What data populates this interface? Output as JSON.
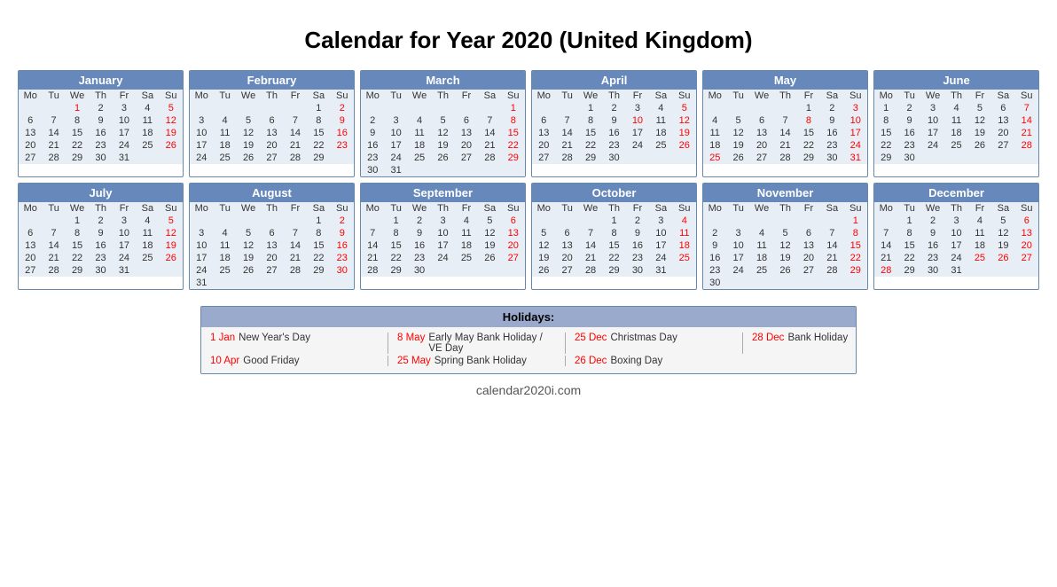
{
  "title": "Calendar for Year 2020 (United Kingdom)",
  "months": [
    {
      "name": "January",
      "days_header": [
        "Mo",
        "Tu",
        "We",
        "Th",
        "Fr",
        "Sa",
        "Su"
      ],
      "weeks": [
        [
          "",
          "",
          "1",
          "2",
          "3",
          "4",
          "5"
        ],
        [
          "6",
          "7",
          "8",
          "9",
          "10",
          "11",
          "12"
        ],
        [
          "13",
          "14",
          "15",
          "16",
          "17",
          "18",
          "19"
        ],
        [
          "20",
          "21",
          "22",
          "23",
          "24",
          "25",
          "26"
        ],
        [
          "27",
          "28",
          "29",
          "30",
          "31",
          "",
          ""
        ]
      ],
      "red_days": [
        "1"
      ]
    },
    {
      "name": "February",
      "days_header": [
        "Mo",
        "Tu",
        "We",
        "Th",
        "Fr",
        "Sa",
        "Su"
      ],
      "weeks": [
        [
          "",
          "",
          "",
          "",
          "",
          "1",
          "2"
        ],
        [
          "3",
          "4",
          "5",
          "6",
          "7",
          "8",
          "9"
        ],
        [
          "10",
          "11",
          "12",
          "13",
          "14",
          "15",
          "16"
        ],
        [
          "17",
          "18",
          "19",
          "20",
          "21",
          "22",
          "23"
        ],
        [
          "24",
          "25",
          "26",
          "27",
          "28",
          "29",
          ""
        ]
      ],
      "red_days": []
    },
    {
      "name": "March",
      "days_header": [
        "Mo",
        "Tu",
        "We",
        "Th",
        "Fr",
        "Sa",
        "Su"
      ],
      "weeks": [
        [
          "",
          "",
          "",
          "",
          "",
          "",
          "1"
        ],
        [
          "2",
          "3",
          "4",
          "5",
          "6",
          "7",
          "8"
        ],
        [
          "9",
          "10",
          "11",
          "12",
          "13",
          "14",
          "15"
        ],
        [
          "16",
          "17",
          "18",
          "19",
          "20",
          "21",
          "22"
        ],
        [
          "23",
          "24",
          "25",
          "26",
          "27",
          "28",
          "29"
        ],
        [
          "30",
          "31",
          "",
          "",
          "",
          "",
          ""
        ]
      ],
      "red_days": []
    },
    {
      "name": "April",
      "days_header": [
        "Mo",
        "Tu",
        "We",
        "Th",
        "Fr",
        "Sa",
        "Su"
      ],
      "weeks": [
        [
          "",
          "",
          "1",
          "2",
          "3",
          "4",
          "5"
        ],
        [
          "6",
          "7",
          "8",
          "9",
          "10",
          "11",
          "12"
        ],
        [
          "13",
          "14",
          "15",
          "16",
          "17",
          "18",
          "19"
        ],
        [
          "20",
          "21",
          "22",
          "23",
          "24",
          "25",
          "26"
        ],
        [
          "27",
          "28",
          "29",
          "30",
          "",
          "",
          ""
        ]
      ],
      "red_days": [
        "10"
      ]
    },
    {
      "name": "May",
      "days_header": [
        "Mo",
        "Tu",
        "We",
        "Th",
        "Fr",
        "Sa",
        "Su"
      ],
      "weeks": [
        [
          "",
          "",
          "",
          "",
          "1",
          "2",
          "3"
        ],
        [
          "4",
          "5",
          "6",
          "7",
          "8",
          "9",
          "10"
        ],
        [
          "11",
          "12",
          "13",
          "14",
          "15",
          "16",
          "17"
        ],
        [
          "18",
          "19",
          "20",
          "21",
          "22",
          "23",
          "24"
        ],
        [
          "25",
          "26",
          "27",
          "28",
          "29",
          "30",
          "31"
        ]
      ],
      "red_days": [
        "8",
        "25"
      ]
    },
    {
      "name": "June",
      "days_header": [
        "Mo",
        "Tu",
        "We",
        "Th",
        "Fr",
        "Sa",
        "Su"
      ],
      "weeks": [
        [
          "1",
          "2",
          "3",
          "4",
          "5",
          "6",
          "7"
        ],
        [
          "8",
          "9",
          "10",
          "11",
          "12",
          "13",
          "14"
        ],
        [
          "15",
          "16",
          "17",
          "18",
          "19",
          "20",
          "21"
        ],
        [
          "22",
          "23",
          "24",
          "25",
          "26",
          "27",
          "28"
        ],
        [
          "29",
          "30",
          "",
          "",
          "",
          "",
          ""
        ]
      ],
      "red_days": []
    },
    {
      "name": "July",
      "days_header": [
        "Mo",
        "Tu",
        "We",
        "Th",
        "Fr",
        "Sa",
        "Su"
      ],
      "weeks": [
        [
          "",
          "",
          "1",
          "2",
          "3",
          "4",
          "5"
        ],
        [
          "6",
          "7",
          "8",
          "9",
          "10",
          "11",
          "12"
        ],
        [
          "13",
          "14",
          "15",
          "16",
          "17",
          "18",
          "19"
        ],
        [
          "20",
          "21",
          "22",
          "23",
          "24",
          "25",
          "26"
        ],
        [
          "27",
          "28",
          "29",
          "30",
          "31",
          "",
          ""
        ]
      ],
      "red_days": []
    },
    {
      "name": "August",
      "days_header": [
        "Mo",
        "Tu",
        "We",
        "Th",
        "Fr",
        "Sa",
        "Su"
      ],
      "weeks": [
        [
          "",
          "",
          "",
          "",
          "",
          "1",
          "2"
        ],
        [
          "3",
          "4",
          "5",
          "6",
          "7",
          "8",
          "9"
        ],
        [
          "10",
          "11",
          "12",
          "13",
          "14",
          "15",
          "16"
        ],
        [
          "17",
          "18",
          "19",
          "20",
          "21",
          "22",
          "23"
        ],
        [
          "24",
          "25",
          "26",
          "27",
          "28",
          "29",
          "30"
        ],
        [
          "31",
          "",
          "",
          "",
          "",
          "",
          ""
        ]
      ],
      "red_days": []
    },
    {
      "name": "September",
      "days_header": [
        "Mo",
        "Tu",
        "We",
        "Th",
        "Fr",
        "Sa",
        "Su"
      ],
      "weeks": [
        [
          "",
          "1",
          "2",
          "3",
          "4",
          "5",
          "6"
        ],
        [
          "7",
          "8",
          "9",
          "10",
          "11",
          "12",
          "13"
        ],
        [
          "14",
          "15",
          "16",
          "17",
          "18",
          "19",
          "20"
        ],
        [
          "21",
          "22",
          "23",
          "24",
          "25",
          "26",
          "27"
        ],
        [
          "28",
          "29",
          "30",
          "",
          "",
          "",
          ""
        ]
      ],
      "red_days": []
    },
    {
      "name": "October",
      "days_header": [
        "Mo",
        "Tu",
        "We",
        "Th",
        "Fr",
        "Sa",
        "Su"
      ],
      "weeks": [
        [
          "",
          "",
          "",
          "1",
          "2",
          "3",
          "4"
        ],
        [
          "5",
          "6",
          "7",
          "8",
          "9",
          "10",
          "11"
        ],
        [
          "12",
          "13",
          "14",
          "15",
          "16",
          "17",
          "18"
        ],
        [
          "19",
          "20",
          "21",
          "22",
          "23",
          "24",
          "25"
        ],
        [
          "26",
          "27",
          "28",
          "29",
          "30",
          "31",
          ""
        ]
      ],
      "red_days": []
    },
    {
      "name": "November",
      "days_header": [
        "Mo",
        "Tu",
        "We",
        "Th",
        "Fr",
        "Sa",
        "Su"
      ],
      "weeks": [
        [
          "",
          "",
          "",
          "",
          "",
          "",
          "1"
        ],
        [
          "2",
          "3",
          "4",
          "5",
          "6",
          "7",
          "8"
        ],
        [
          "9",
          "10",
          "11",
          "12",
          "13",
          "14",
          "15"
        ],
        [
          "16",
          "17",
          "18",
          "19",
          "20",
          "21",
          "22"
        ],
        [
          "23",
          "24",
          "25",
          "26",
          "27",
          "28",
          "29"
        ],
        [
          "30",
          "",
          "",
          "",
          "",
          "",
          ""
        ]
      ],
      "red_days": []
    },
    {
      "name": "December",
      "days_header": [
        "Mo",
        "Tu",
        "We",
        "Th",
        "Fr",
        "Sa",
        "Su"
      ],
      "weeks": [
        [
          "",
          "1",
          "2",
          "3",
          "4",
          "5",
          "6"
        ],
        [
          "7",
          "8",
          "9",
          "10",
          "11",
          "12",
          "13"
        ],
        [
          "14",
          "15",
          "16",
          "17",
          "18",
          "19",
          "20"
        ],
        [
          "21",
          "22",
          "23",
          "24",
          "25",
          "26",
          "27"
        ],
        [
          "28",
          "29",
          "30",
          "31",
          "",
          "",
          ""
        ]
      ],
      "red_days": [
        "25",
        "26",
        "28"
      ]
    }
  ],
  "holidays": {
    "header": "Holidays:",
    "rows": [
      [
        {
          "date": "1 Jan",
          "name": "New Year's Day"
        },
        {
          "date": "8 May",
          "name": "Early May Bank Holiday / VE Day"
        },
        {
          "date": "25 Dec",
          "name": "Christmas Day"
        },
        {
          "date": "28 Dec",
          "name": "Bank Holiday"
        }
      ],
      [
        {
          "date": "10 Apr",
          "name": "Good Friday"
        },
        {
          "date": "25 May",
          "name": "Spring Bank Holiday"
        },
        {
          "date": "26 Dec",
          "name": "Boxing Day"
        },
        {
          "date": "",
          "name": ""
        }
      ]
    ]
  },
  "footer": "calendar2020i.com"
}
